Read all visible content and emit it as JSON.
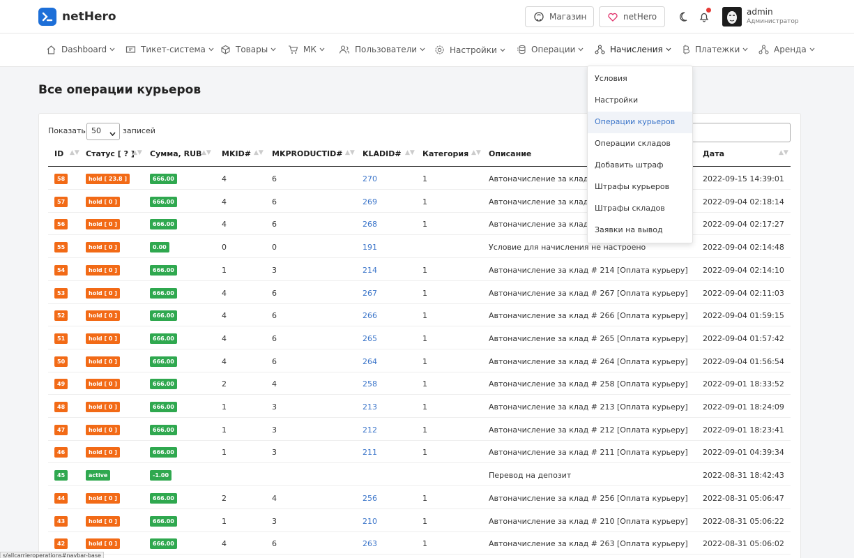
{
  "app": {
    "name": "netHero"
  },
  "top_buttons": {
    "shop": "Магазин",
    "nethero": "netHero"
  },
  "user": {
    "name": "admin",
    "role": "Администратор"
  },
  "nav": [
    {
      "label": "Dashboard",
      "icon": "home-icon"
    },
    {
      "label": "Тикет-система",
      "icon": "ticket-icon"
    },
    {
      "label": "Товары",
      "icon": "box-icon"
    },
    {
      "label": "МК",
      "icon": "cart-icon"
    },
    {
      "label": "Пользователи",
      "icon": "users-icon"
    },
    {
      "label": "Настройки",
      "icon": "gear-icon"
    },
    {
      "label": "Операции",
      "icon": "coins-icon"
    },
    {
      "label": "Начисления",
      "icon": "nodes-icon"
    },
    {
      "label": "Платежки",
      "icon": "bitcoin-icon"
    },
    {
      "label": "Аренда",
      "icon": "nodes-icon"
    }
  ],
  "page": {
    "title": "Все операции курьеров"
  },
  "table_controls": {
    "show_label": "Показать",
    "page_size": "50",
    "records_label": "записей"
  },
  "columns": [
    "ID",
    "Статус [ ? ]",
    "Сумма, RUB",
    "MKID#",
    "MKPRODUCTID#",
    "KLADID#",
    "Категория",
    "Описание",
    "Дата"
  ],
  "rows": [
    {
      "id": "58",
      "status": "hold [ 23.8 ]",
      "amount": "666.00",
      "mkid": "4",
      "mkproductid": "6",
      "kladid": "270",
      "category": "1",
      "description": "Автоначисление за клад",
      "date": "2022-09-15 14:39:01"
    },
    {
      "id": "57",
      "status": "hold [ 0 ]",
      "amount": "666.00",
      "mkid": "4",
      "mkproductid": "6",
      "kladid": "269",
      "category": "1",
      "description": "Автоначисление за клад",
      "date": "2022-09-04 02:18:14"
    },
    {
      "id": "56",
      "status": "hold [ 0 ]",
      "amount": "666.00",
      "mkid": "4",
      "mkproductid": "6",
      "kladid": "268",
      "category": "1",
      "description": "Автоначисление за клад",
      "date": "2022-09-04 02:17:27"
    },
    {
      "id": "55",
      "status": "hold [ 0 ]",
      "amount": "0.00",
      "mkid": "0",
      "mkproductid": "0",
      "kladid": "191",
      "category": "",
      "description": "Условие для начисления не настроено",
      "date": "2022-09-04 02:14:48"
    },
    {
      "id": "54",
      "status": "hold [ 0 ]",
      "amount": "666.00",
      "mkid": "1",
      "mkproductid": "3",
      "kladid": "214",
      "category": "1",
      "description": "Автоначисление за клад # 214 [Оплата курьеру]",
      "date": "2022-09-04 02:14:10"
    },
    {
      "id": "53",
      "status": "hold [ 0 ]",
      "amount": "666.00",
      "mkid": "4",
      "mkproductid": "6",
      "kladid": "267",
      "category": "1",
      "description": "Автоначисление за клад # 267 [Оплата курьеру]",
      "date": "2022-09-04 02:11:03"
    },
    {
      "id": "52",
      "status": "hold [ 0 ]",
      "amount": "666.00",
      "mkid": "4",
      "mkproductid": "6",
      "kladid": "266",
      "category": "1",
      "description": "Автоначисление за клад # 266 [Оплата курьеру]",
      "date": "2022-09-04 01:59:15"
    },
    {
      "id": "51",
      "status": "hold [ 0 ]",
      "amount": "666.00",
      "mkid": "4",
      "mkproductid": "6",
      "kladid": "265",
      "category": "1",
      "description": "Автоначисление за клад # 265 [Оплата курьеру]",
      "date": "2022-09-04 01:57:42"
    },
    {
      "id": "50",
      "status": "hold [ 0 ]",
      "amount": "666.00",
      "mkid": "4",
      "mkproductid": "6",
      "kladid": "264",
      "category": "1",
      "description": "Автоначисление за клад # 264 [Оплата курьеру]",
      "date": "2022-09-04 01:56:54"
    },
    {
      "id": "49",
      "status": "hold [ 0 ]",
      "amount": "666.00",
      "mkid": "2",
      "mkproductid": "4",
      "kladid": "258",
      "category": "1",
      "description": "Автоначисление за клад # 258 [Оплата курьеру]",
      "date": "2022-09-01 18:33:52"
    },
    {
      "id": "48",
      "status": "hold [ 0 ]",
      "amount": "666.00",
      "mkid": "1",
      "mkproductid": "3",
      "kladid": "213",
      "category": "1",
      "description": "Автоначисление за клад # 213 [Оплата курьеру]",
      "date": "2022-09-01 18:24:09"
    },
    {
      "id": "47",
      "status": "hold [ 0 ]",
      "amount": "666.00",
      "mkid": "1",
      "mkproductid": "3",
      "kladid": "212",
      "category": "1",
      "description": "Автоначисление за клад # 212 [Оплата курьеру]",
      "date": "2022-09-01 18:23:41"
    },
    {
      "id": "46",
      "status": "hold [ 0 ]",
      "amount": "666.00",
      "mkid": "1",
      "mkproductid": "3",
      "kladid": "211",
      "category": "1",
      "description": "Автоначисление за клад # 211 [Оплата курьеру]",
      "date": "2022-09-01 04:39:34"
    },
    {
      "id": "45",
      "status": "active",
      "amount": "-1.00",
      "mkid": "",
      "mkproductid": "",
      "kladid": "",
      "category": "",
      "description": "Перевод на депозит",
      "date": "2022-08-31 18:42:43"
    },
    {
      "id": "44",
      "status": "hold [ 0 ]",
      "amount": "666.00",
      "mkid": "2",
      "mkproductid": "4",
      "kladid": "256",
      "category": "1",
      "description": "Автоначисление за клад # 256 [Оплата курьеру]",
      "date": "2022-08-31 05:06:47"
    },
    {
      "id": "43",
      "status": "hold [ 0 ]",
      "amount": "666.00",
      "mkid": "1",
      "mkproductid": "3",
      "kladid": "210",
      "category": "1",
      "description": "Автоначисление за клад # 210 [Оплата курьеру]",
      "date": "2022-08-31 05:06:22"
    },
    {
      "id": "42",
      "status": "hold [ 0 ]",
      "amount": "666.00",
      "mkid": "4",
      "mkproductid": "6",
      "kladid": "263",
      "category": "1",
      "description": "Автоначисление за клад # 263 [Оплата курьеру]",
      "date": "2022-08-31 05:06:02"
    }
  ],
  "dropdown": {
    "items": [
      "Условия",
      "Настройки",
      "Операции курьеров",
      "Операции складов",
      "Добавить штраф",
      "Штрафы курьеров",
      "Штрафы складов",
      "Заявки на вывод"
    ],
    "active": "Операции курьеров"
  },
  "status_bar": {
    "url": "s/allcarrieroperations#navbar-base"
  },
  "colors": {
    "accent": "#1d6fd8",
    "hold": "#f26a16",
    "active": "#2fa84f",
    "link": "#3a74c9"
  }
}
